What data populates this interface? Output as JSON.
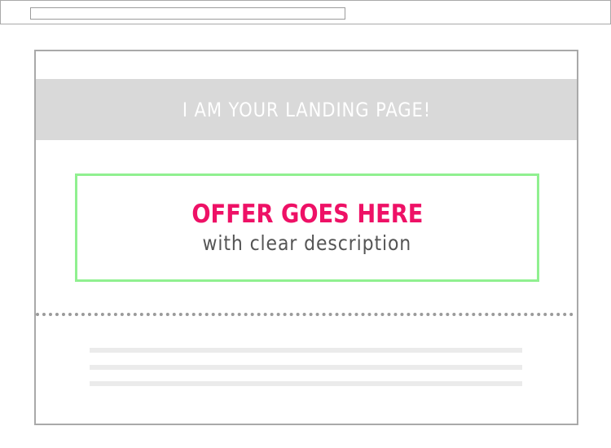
{
  "hero": {
    "title": "I AM YOUR LANDING PAGE!"
  },
  "offer": {
    "headline": "OFFER GOES HERE",
    "description": "with clear description"
  },
  "colors": {
    "banner_bg": "#d9d9d9",
    "offer_border": "#90f090",
    "headline": "#ee1166",
    "description": "#555555",
    "fold_line": "#9a9a9a",
    "placeholder_line": "#ebebeb"
  }
}
